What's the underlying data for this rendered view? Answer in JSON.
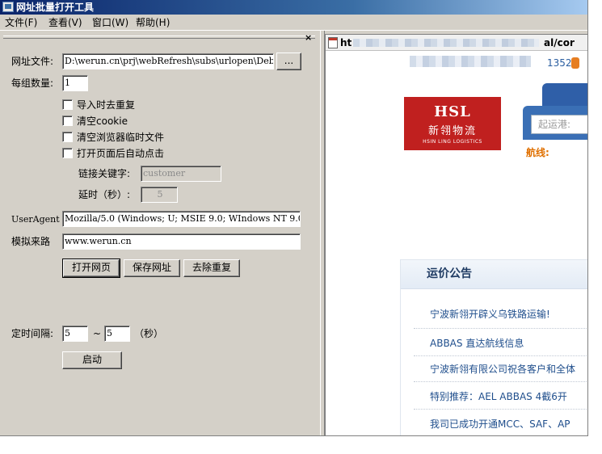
{
  "window": {
    "title": "网址批量打开工具"
  },
  "menu": {
    "file": "文件(F)",
    "view": "查看(V)",
    "window": "窗口(W)",
    "help": "帮助(H)"
  },
  "panel": {
    "close": "×"
  },
  "form": {
    "url_file_label": "网址文件:",
    "url_file_value": "D:\\werun.cn\\prj\\webRefresh\\subs\\urlopen\\Deb",
    "browse_button": "...",
    "group_count_label": "每组数量:",
    "group_count_value": "1",
    "checkboxes": [
      {
        "label": "导入时去重复",
        "checked": false
      },
      {
        "label": "清空cookie",
        "checked": false
      },
      {
        "label": "清空浏览器临时文件",
        "checked": false
      },
      {
        "label": "打开页面后自动点击",
        "checked": false
      }
    ],
    "link_keyword_label": "链接关键字:",
    "link_keyword_placeholder": "customer",
    "delay_label": "延时（秒）:",
    "delay_value": "5",
    "useragent_label": "UserAgent",
    "useragent_value": "Mozilla/5.0 (Windows; U; MSIE 9.0; WIndows NT 9.0",
    "referer_label": "模拟来路",
    "referer_value": "www.werun.cn",
    "open_button": "打开网页",
    "save_button": "保存网址",
    "dedupe_button": "去除重复",
    "interval_label": "定时间隔:",
    "interval_from": "5",
    "interval_sep": "~",
    "interval_to": "5",
    "interval_unit": "（秒）",
    "start_button": "启动"
  },
  "browser": {
    "url_prefix": "ht",
    "url_suffix": "al/cor",
    "phone_fragment": "1352",
    "logo_main": "HSL",
    "logo_cn": "新翎物流",
    "logo_en": "HSIN LING LOGISTICS",
    "search_placeholder": "起运港:",
    "route_label": "航线:",
    "notice_title": "运价公告",
    "notice_items": [
      "宁波新翎开辟义乌铁路运输!",
      "ABBAS 直达航线信息",
      "宁波新翎有限公司祝各客户和全体",
      "特别推荐：AEL ABBAS 4截6开",
      "我司已成功开通MCC、SAF、AP"
    ]
  },
  "colors": {
    "title_bar": "#0a246a",
    "logo_red": "#c0201f",
    "route_orange": "#e07000",
    "link_blue": "#1f4e8c"
  }
}
